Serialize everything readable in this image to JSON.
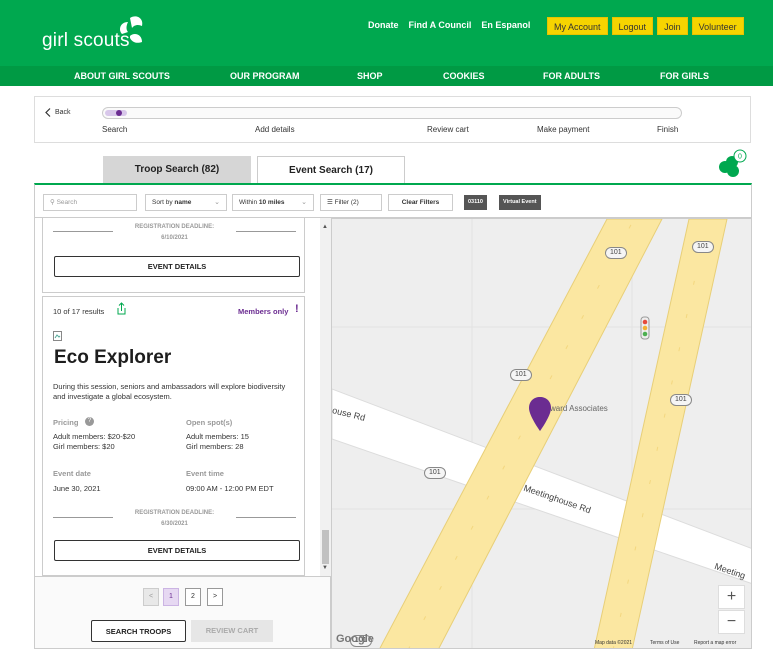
{
  "header": {
    "logo": "girl scouts",
    "links": [
      "Donate",
      "Find A Council",
      "En Espanol"
    ],
    "buttons": [
      "My Account",
      "Logout",
      "Join",
      "Volunteer"
    ],
    "nav": [
      "ABOUT GIRL SCOUTS",
      "OUR PROGRAM",
      "SHOP",
      "COOKIES",
      "FOR ADULTS",
      "FOR GIRLS"
    ]
  },
  "progress": {
    "back": "Back",
    "steps": [
      "Search",
      "Add details",
      "Review cart",
      "Make payment",
      "Finish"
    ]
  },
  "tabs": {
    "troop": "Troop Search (82)",
    "event": "Event Search (17)"
  },
  "cookie_badge": "0",
  "filters": {
    "search_placeholder": "Search",
    "sort_prefix": "Sort by",
    "sort_value": "name",
    "within_prefix": "Within",
    "within_value": "10 miles",
    "filter": "Filter (2)",
    "clear": "Clear Filters",
    "chips": [
      "03110",
      "Virtual Event"
    ]
  },
  "prev_card": {
    "deadline_label": "REGISTRATION DEADLINE:",
    "deadline_date": "6/10/2021",
    "details": "EVENT DETAILS"
  },
  "card": {
    "results": "10 of 17 results",
    "members_only": "Members only",
    "title": "Eco Explorer",
    "description": "During this session, seniors and ambassadors will explore biodiversity and investigate a global ecosystem.",
    "pricing_label": "Pricing",
    "pricing_adult": "Adult members: $20-$20",
    "pricing_girl": "Girl members: $20",
    "spots_label": "Open spot(s)",
    "spots_adult": "Adult members: 15",
    "spots_girl": "Girl members: 28",
    "date_label": "Event date",
    "date_value": "June 30, 2021",
    "time_label": "Event time",
    "time_value": "09:00 AM - 12:00 PM EDT",
    "deadline_label": "REGISTRATION DEADLINE:",
    "deadline_date": "6/30/2021",
    "details": "EVENT DETAILS"
  },
  "pagination": {
    "prev": "<",
    "pages": [
      "1",
      "2"
    ],
    "next": ">"
  },
  "actions": {
    "search_troops": "SEARCH TROOPS",
    "review_cart": "REVIEW CART"
  },
  "map": {
    "shields": [
      "101",
      "101",
      "101",
      "101",
      "101",
      "101"
    ],
    "roads": [
      "ouse Rd",
      "Meetinghouse Rd",
      "Meeting"
    ],
    "place": "ward Associates",
    "zoom_in": "+",
    "zoom_out": "−",
    "google": "Google",
    "footer": [
      "Map data ©2021",
      "Terms of Use",
      "Report a map error"
    ]
  }
}
